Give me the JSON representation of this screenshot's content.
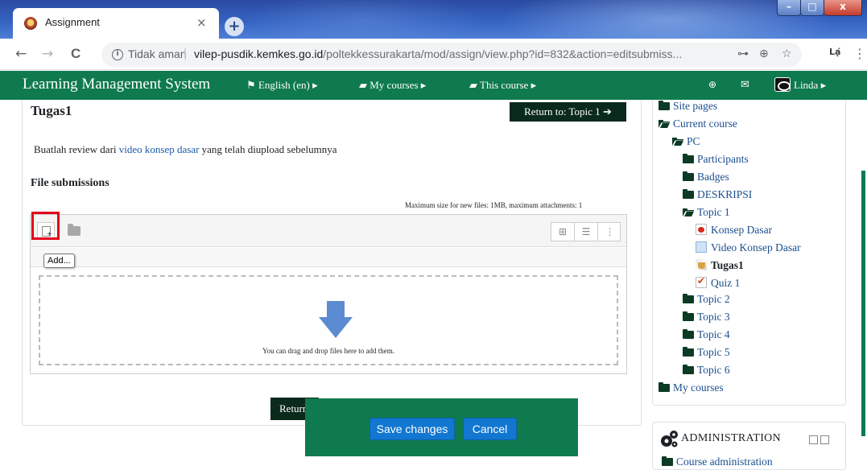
{
  "browser": {
    "tab_title": "Assignment",
    "tab_close": "×",
    "new_tab": "+",
    "window_buttons": {
      "minimize": "–",
      "maximize": "□",
      "close": "x"
    },
    "nav": {
      "back": "←",
      "forward": "→",
      "reload": "C"
    },
    "security_label": "Tidak aman",
    "url_host": "vilep-pusdik.kemkes.go.id",
    "url_rest": "/poltekkessurakarta/mod/assign/view.php?id=832&action=editsubmiss...",
    "extension_label": "Lạ́"
  },
  "navbar": {
    "brand": "Learning Management System",
    "language": "English (en)",
    "my_courses": "My courses",
    "this_course": "This course",
    "user": "Linda"
  },
  "main": {
    "title": "Tugas1",
    "return_topic": "Return to: Topic 1",
    "intro_before": "Buatlah review dari ",
    "intro_link": "video konsep dasar",
    "intro_after": " yang telah diupload sebelumnya",
    "file_submissions_label": "File submissions",
    "max_size": "Maximum size for new files: 1MB, maximum attachments: 1",
    "tooltip": "Add...",
    "drop_text": "You can drag and drop files here to add them.",
    "return_bottom": "Return",
    "save_button": "Save changes",
    "cancel_button": "Cancel"
  },
  "sidebar": {
    "items": [
      {
        "label": "Site pages",
        "icon": "folder-icon"
      },
      {
        "label": "Current course",
        "icon": "folder-open-icon"
      },
      {
        "label": "PC",
        "icon": "folder-open-icon"
      },
      {
        "label": "Participants",
        "icon": "folder-icon"
      },
      {
        "label": "Badges",
        "icon": "folder-icon"
      },
      {
        "label": "DESKRIPSI",
        "icon": "folder-icon"
      },
      {
        "label": "Topic 1",
        "icon": "folder-open-icon"
      },
      {
        "label": "Konsep Dasar",
        "icon": "pdf-icon"
      },
      {
        "label": "Video Konsep Dasar",
        "icon": "page-icon"
      },
      {
        "label": "Tugas1",
        "icon": "assignment-icon"
      },
      {
        "label": "Quiz 1",
        "icon": "quiz-icon"
      },
      {
        "label": "Topic 2",
        "icon": "folder-icon"
      },
      {
        "label": "Topic 3",
        "icon": "folder-icon"
      },
      {
        "label": "Topic 4",
        "icon": "folder-icon"
      },
      {
        "label": "Topic 5",
        "icon": "folder-icon"
      },
      {
        "label": "Topic 6",
        "icon": "folder-icon"
      },
      {
        "label": "My courses",
        "icon": "folder-icon"
      }
    ],
    "admin_title": "ADMINISTRATION",
    "course_admin": "Course administration"
  },
  "colors": {
    "brand_green": "#0f7a4e",
    "button_blue": "#1177d1",
    "highlight_red": "#e3001b",
    "dark_button": "#0a2a1c"
  }
}
